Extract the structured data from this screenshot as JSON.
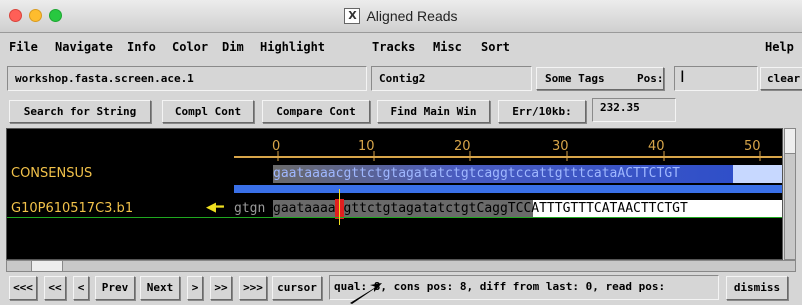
{
  "window": {
    "title": "Aligned Reads"
  },
  "menus": [
    "File",
    "Navigate",
    "Info",
    "Color",
    "Dim",
    "Highlight",
    "Tracks",
    "Misc",
    "Sort",
    "Help"
  ],
  "row1": {
    "filename": "workshop.fasta.screen.ace.1",
    "contig": "Contig2",
    "some_tags": "Some   Tags",
    "pos_label": "Pos:",
    "pos_value": "",
    "clear": "clear"
  },
  "row2": {
    "search": "Search for String",
    "compl": "Compl Cont",
    "compare": "Compare Cont",
    "find_main": "Find Main Win",
    "err_label": "Err/10kb:",
    "err_value": "232.35"
  },
  "ruler": {
    "ticks": [
      "0",
      "10",
      "20",
      "30",
      "40",
      "50"
    ]
  },
  "rows": [
    {
      "label": "CONSENSUS",
      "pre": "",
      "sequence": "gaataaaacgttctgtagatatctgtcaggtccattgtttcataACTTCTGT"
    },
    {
      "label": "G10P610517C3.b1",
      "pre": "gtgn",
      "sequence": "gaataaaacgttctgtagatatctgtCaggTCCATTTGTTTCATAACTTCTGT"
    }
  ],
  "navigation": {
    "first": "<<<",
    "prev2": "<<",
    "prev1": "<",
    "prev_word": "Prev",
    "next_word": "Next",
    "next1": ">",
    "next2": ">>",
    "last": ">>>",
    "cursor": "cursor",
    "dismiss": "dismiss"
  },
  "status": "qual: 8, cons pos: 8, diff from last: 0, read pos:",
  "colors": {
    "background": "#000000",
    "ruler": "#d7a54a",
    "label": "#f2c24a",
    "highlight": "#e02020",
    "consensus_band": "#2f4fc9"
  }
}
